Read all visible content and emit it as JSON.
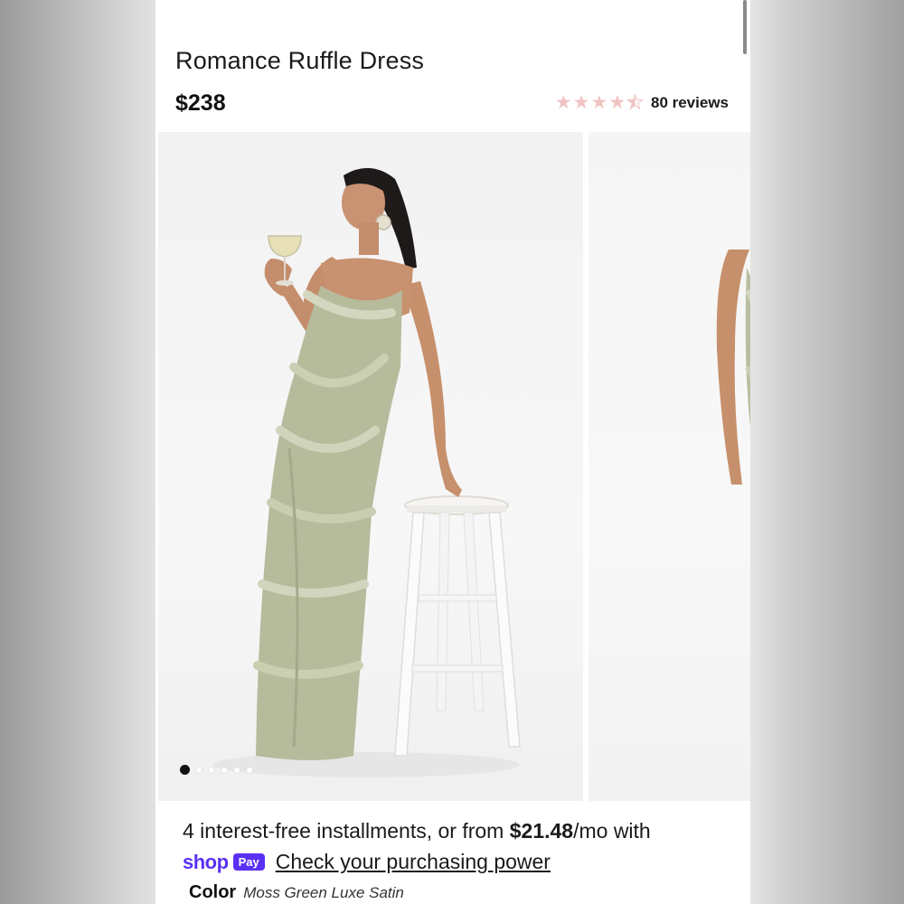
{
  "product": {
    "title": "Romance Ruffle Dress",
    "price": "$238",
    "rating": 4.5,
    "reviews": "80 reviews"
  },
  "gallery": {
    "total_slides": 6,
    "active_slide": 1
  },
  "financing": {
    "text_before": "4 interest-free installments, or from ",
    "amount": "$21.48",
    "text_after": "/mo with",
    "shop_logo": "shop",
    "pay_badge": "Pay",
    "link": "Check your purchasing power"
  },
  "color": {
    "label": "Color",
    "value": "Moss Green Luxe Satin"
  },
  "colors": {
    "star": "#f2c3c3",
    "shop_purple": "#5a31f4",
    "dress": "#b9bea0"
  }
}
